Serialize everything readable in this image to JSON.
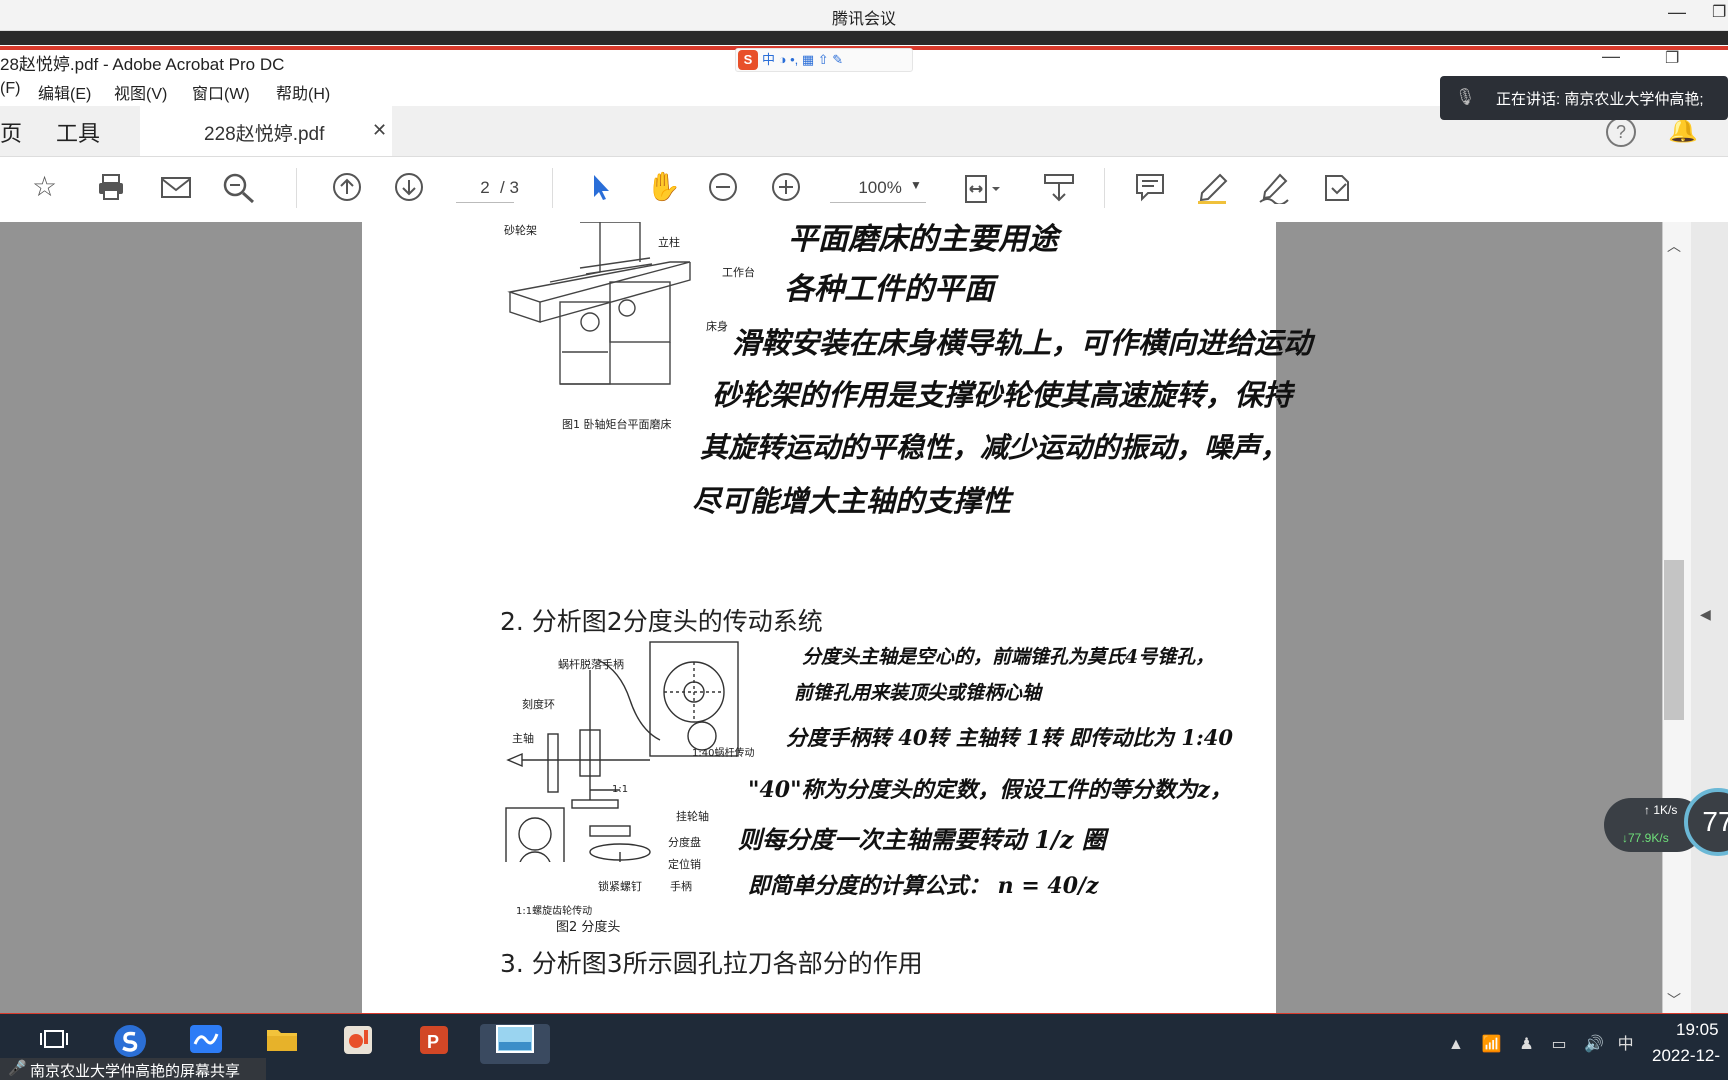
{
  "meeting": {
    "title": "腾讯会议"
  },
  "acrobat": {
    "window_title": "28赵悦婷.pdf - Adobe Acrobat Pro DC",
    "menu": [
      "(F)",
      "编辑(E)",
      "视图(V)",
      "窗口(W)",
      "帮助(H)"
    ],
    "tabs": {
      "home": "页",
      "tools": "工具",
      "document": "228赵悦婷.pdf"
    },
    "toolbar": {
      "current_page": "2",
      "total_pages": "/ 3",
      "zoom": "100%"
    }
  },
  "ime": {
    "logo": "S",
    "label": "中"
  },
  "speaker": {
    "text": "正在讲话: 南京农业大学仲高艳;"
  },
  "document": {
    "figure1": {
      "caption": "图1    卧轴矩台平面磨床",
      "labels": [
        "砂轮架",
        "立柱",
        "工作台",
        "床身"
      ]
    },
    "handwriting1": [
      "平面磨床的主要用途",
      "各种工件的平面",
      "滑鞍安装在床身横导轨上，可作横向进给运动",
      "砂轮架的作用是支撑砂轮使其高速旋转，保持",
      "其旋转运动的平稳性，减少运动的振动，噪声，",
      "尽可能增大主轴的支撑性"
    ],
    "question2": "2. 分析图2分度头的传动系统",
    "figure2": {
      "caption": "图2 分度头",
      "labels": [
        "蜗杆脱落手柄",
        "刻度环",
        "主轴",
        "1:40蜗杆传动",
        "挂轮轴",
        "分度盘",
        "定位销",
        "锁紧螺钉",
        "手柄",
        "1:1螺旋齿轮传动",
        "1:1"
      ]
    },
    "handwriting2": [
      "分度头主轴是空心的，前端锥孔为莫氏4号锥孔，",
      "前锥孔用来装顶尖或锥柄心轴",
      "分度手柄转 40转 主轴转 1转 即传动比为 1:40",
      "\"40\"称为分度头的定数，假设工件的等分数为z，",
      "则每分度一次主轴需要转动 1/z 圈",
      "即简单分度的计算公式：  n = 40/z"
    ],
    "question3": "3. 分析图3所示圆孔拉刀各部分的作用"
  },
  "network": {
    "upload": "1K/s",
    "download": "77.9K/s",
    "percent": "77"
  },
  "taskbar": {
    "share_text": "南京农业大学仲高艳的屏幕共享",
    "time": "19:05",
    "date": "2022-12-",
    "ime": "中"
  }
}
